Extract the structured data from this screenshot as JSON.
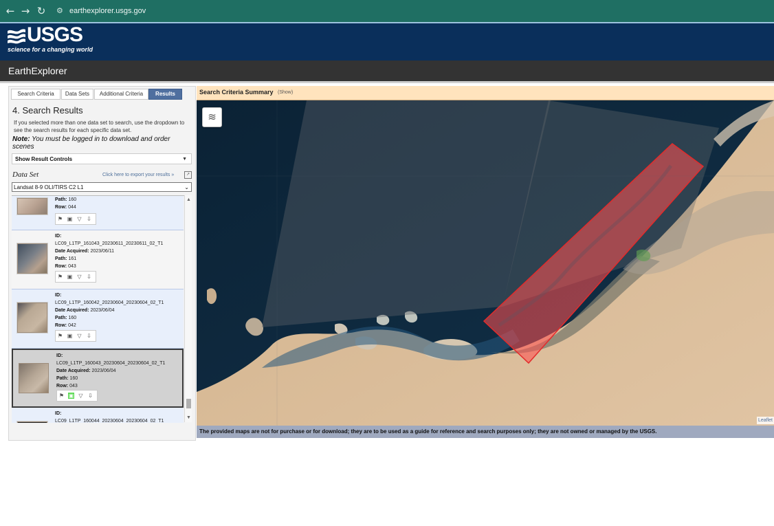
{
  "browser": {
    "back": "←",
    "forward": "→",
    "reload": "↻",
    "url": "earthexplorer.usgs.gov"
  },
  "header": {
    "logo_text": "USGS",
    "tagline": "science for a changing world",
    "app_title": "EarthExplorer"
  },
  "tabs": [
    {
      "label": "Search Criteria"
    },
    {
      "label": "Data Sets"
    },
    {
      "label": "Additional Criteria"
    },
    {
      "label": "Results"
    }
  ],
  "results_panel": {
    "heading": "4. Search Results",
    "help_text": "If you selected more than one data set to search, use the dropdown to see the search results for each specific data set.",
    "note_label": "Note:",
    "note_text": " You must be logged in to download and order scenes",
    "show_result_controls": "Show Result Controls",
    "dataset_label": "Data Set",
    "export_link": "Click here to export your results »",
    "selected_dataset": "Landsat 8-9 OLI/TIRS C2 L1"
  },
  "results": [
    {
      "path": "160",
      "row": "044"
    },
    {
      "id": "LC09_L1TP_161043_20230611_20230611_02_T1",
      "date": "2023/06/11",
      "path": "161",
      "row": "043"
    },
    {
      "id": "LC09_L1TP_160042_20230604_20230604_02_T1",
      "date": "2023/06/04",
      "path": "160",
      "row": "042"
    },
    {
      "id": "LC09_L1TP_160043_20230604_20230604_02_T1",
      "date": "2023/06/04",
      "path": "160",
      "row": "043"
    },
    {
      "id": "LC09_L1TP_160044_20230604_20230604_02_T1"
    }
  ],
  "result_labels": {
    "id": "ID:",
    "date": "Date Acquired:",
    "path": "Path:",
    "row": "Row:"
  },
  "map": {
    "summary_title": "Search Criteria Summary",
    "summary_show": "(Show)",
    "attribution": "Leaflet",
    "disclaimer": "The provided maps are not for purchase or for download; they are to be used as a guide for reference and search purposes only; they are not owned or managed by the USGS."
  },
  "colors": {
    "browser": "#1f6f63",
    "usgs_blue": "#0a2f5b",
    "active_tab": "#4f6f9f",
    "selection": "#ff5050"
  }
}
